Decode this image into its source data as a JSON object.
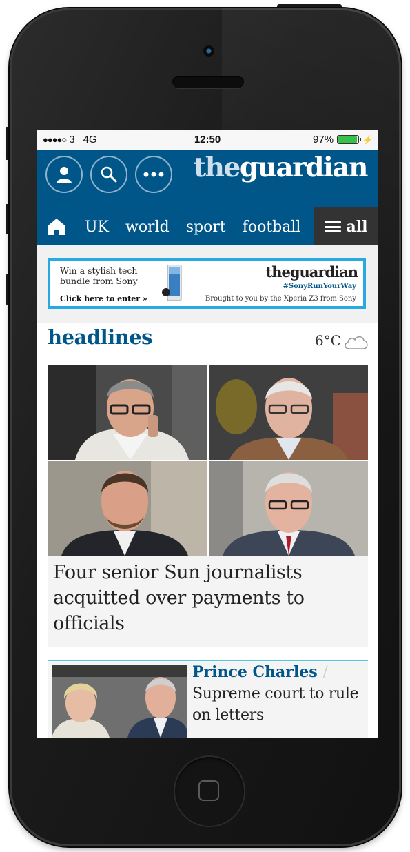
{
  "status_bar": {
    "carrier": "3",
    "network": "4G",
    "time": "12:50",
    "battery": "97%",
    "battery_level": 0.97
  },
  "header": {
    "logo_the": "the",
    "logo_guardian": "guardian",
    "buttons": [
      "profile-icon",
      "search-icon",
      "more-icon"
    ]
  },
  "nav": {
    "items": [
      "UK",
      "world",
      "sport",
      "football"
    ],
    "all_label": "all"
  },
  "ad": {
    "text": "Win a stylish tech bundle from Sony",
    "cta": "Click here to enter »",
    "logo": "theguardian",
    "hashtag": "#SonyRunYourWay",
    "brought": "Brought to you by the Xperia Z3 from Sony"
  },
  "headlines": {
    "title": "headlines",
    "temperature": "6°C",
    "weather_icon": "cloud-icon"
  },
  "top_story": {
    "headline": "Four senior Sun journalists acquitted over payments to officials"
  },
  "story2": {
    "kicker": "Prince Charles",
    "separator": "/",
    "title": "Supreme court to rule on letters"
  },
  "colors": {
    "guardian_blue": "#005689",
    "rule_cyan": "#4bc6df",
    "nav_all_bg": "#333333",
    "ad_border": "#27a9e1"
  }
}
